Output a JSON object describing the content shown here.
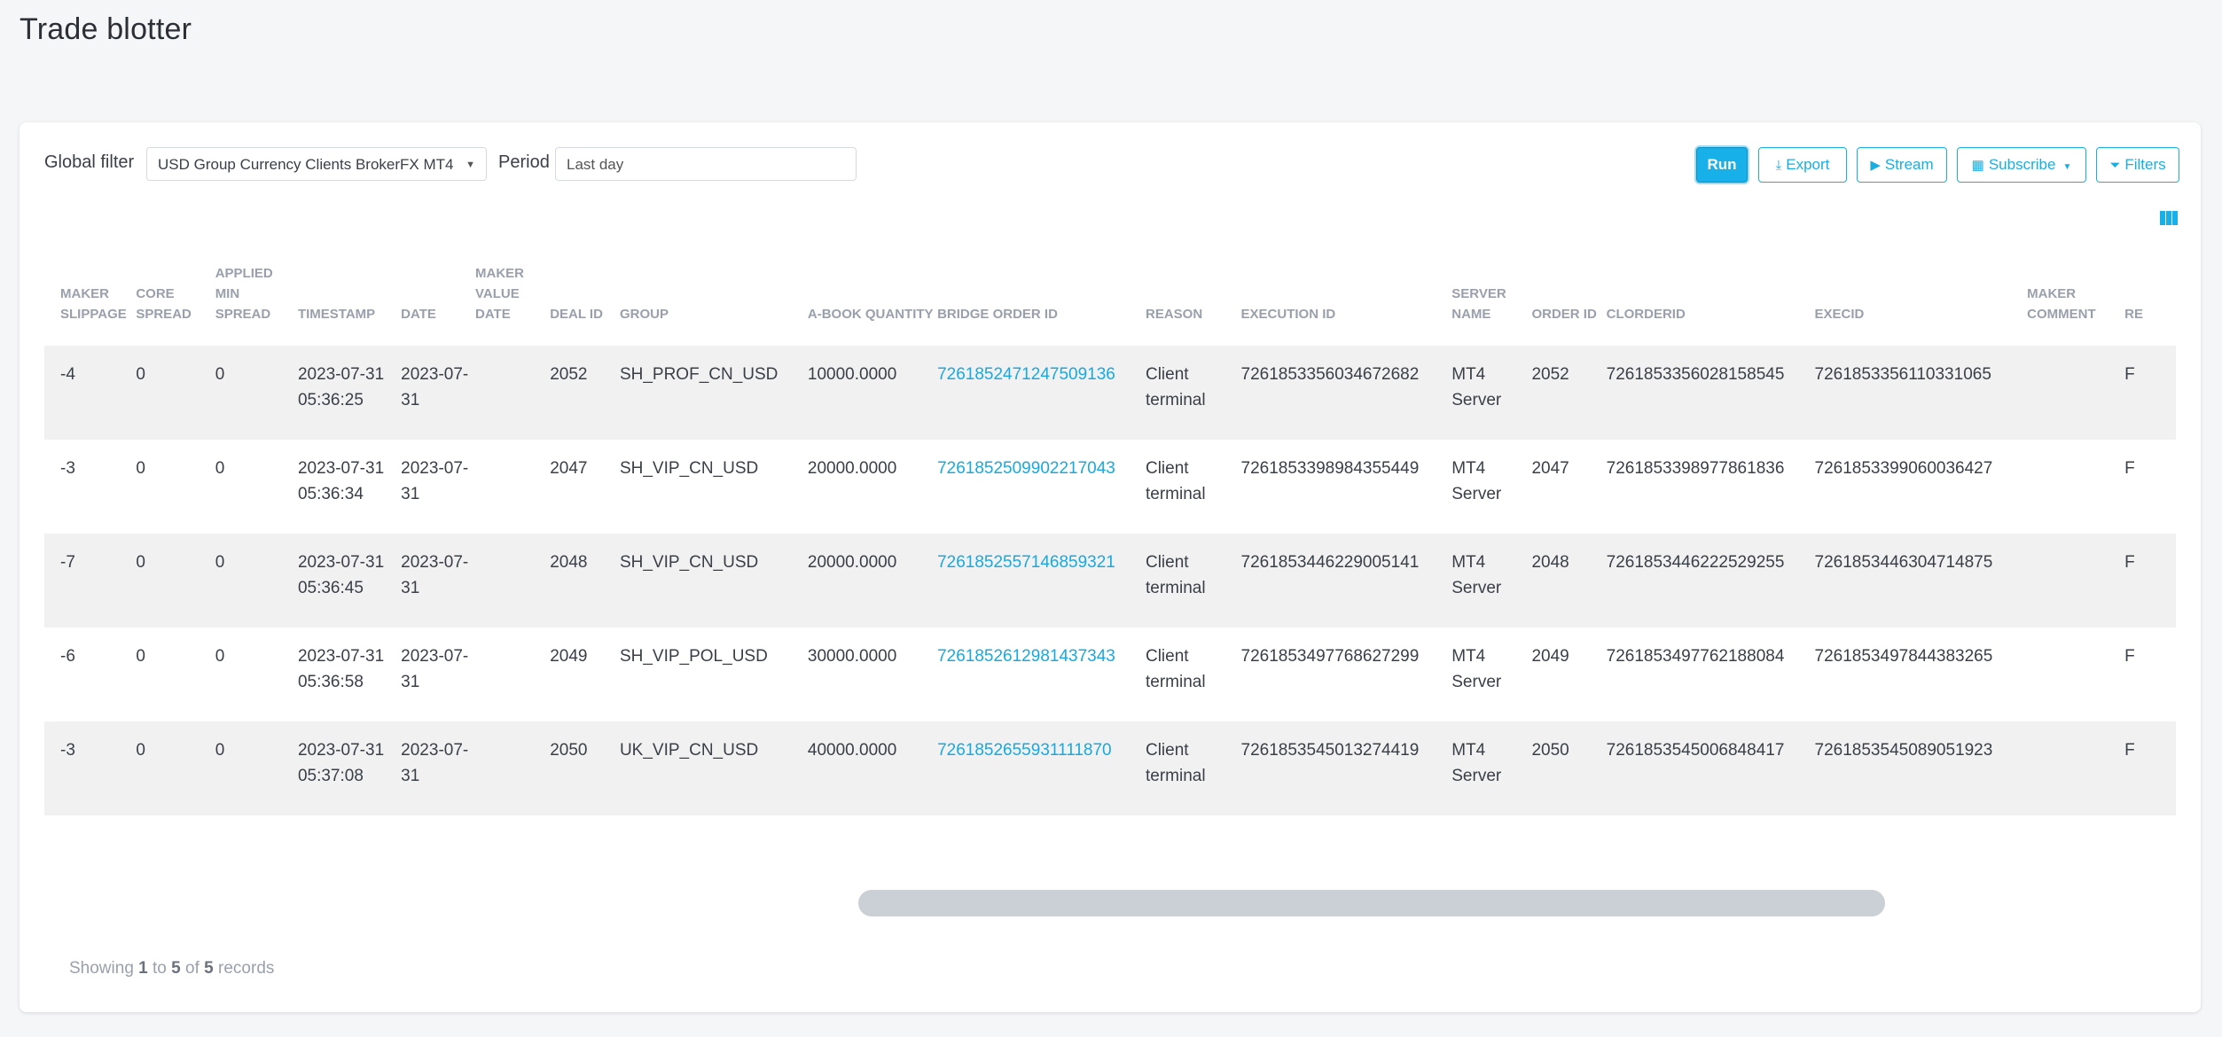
{
  "page": {
    "title": "Trade blotter"
  },
  "toolbar": {
    "global_filter_label": "Global filter",
    "global_filter_value": "USD Group Currency Clients BrokerFX MT4",
    "period_label": "Period",
    "period_value": "Last day",
    "buttons": {
      "run": "Run",
      "export": "Export",
      "stream": "Stream",
      "subscribe": "Subscribe",
      "filters": "Filters"
    },
    "icons": {
      "export": "download-icon",
      "stream": "play-icon",
      "subscribe": "calendar-icon",
      "filters": "funnel-icon",
      "columns": "columns-icon"
    }
  },
  "table": {
    "headers": [
      "MAKER SLIPPAGE",
      "CORE SPREAD",
      "APPLIED MIN SPREAD",
      "TIMESTAMP",
      "DATE",
      "MAKER VALUE DATE",
      "DEAL ID",
      "GROUP",
      "A-BOOK QUANTITY",
      "BRIDGE ORDER ID",
      "REASON",
      "EXECUTION ID",
      "SERVER NAME",
      "ORDER ID",
      "CLORDERID",
      "EXECID",
      "MAKER COMMENT",
      "RE"
    ],
    "rows": [
      [
        "-4",
        "0",
        "0",
        "2023-07-31 05:36:25",
        "2023-07-31",
        "",
        "2052",
        "SH_PROF_CN_USD",
        "10000.0000",
        "7261852471247509136",
        "Client terminal",
        "7261853356034672682",
        "MT4 Server",
        "2052",
        "7261853356028158545",
        "7261853356110331065",
        "",
        "F"
      ],
      [
        "-3",
        "0",
        "0",
        "2023-07-31 05:36:34",
        "2023-07-31",
        "",
        "2047",
        "SH_VIP_CN_USD",
        "20000.0000",
        "7261852509902217043",
        "Client terminal",
        "7261853398984355449",
        "MT4 Server",
        "2047",
        "7261853398977861836",
        "7261853399060036427",
        "",
        "F"
      ],
      [
        "-7",
        "0",
        "0",
        "2023-07-31 05:36:45",
        "2023-07-31",
        "",
        "2048",
        "SH_VIP_CN_USD",
        "20000.0000",
        "7261852557146859321",
        "Client terminal",
        "7261853446229005141",
        "MT4 Server",
        "2048",
        "7261853446222529255",
        "7261853446304714875",
        "",
        "F"
      ],
      [
        "-6",
        "0",
        "0",
        "2023-07-31 05:36:58",
        "2023-07-31",
        "",
        "2049",
        "SH_VIP_POL_USD",
        "30000.0000",
        "7261852612981437343",
        "Client terminal",
        "7261853497768627299",
        "MT4 Server",
        "2049",
        "7261853497762188084",
        "7261853497844383265",
        "",
        "F"
      ],
      [
        "-3",
        "0",
        "0",
        "2023-07-31 05:37:08",
        "2023-07-31",
        "",
        "2050",
        "UK_VIP_CN_USD",
        "40000.0000",
        "7261852655931111870",
        "Client terminal",
        "7261853545013274419",
        "MT4 Server",
        "2050",
        "7261853545006848417",
        "7261853545089051923",
        "",
        "F"
      ]
    ]
  },
  "footer": {
    "prefix": "Showing",
    "from": "1",
    "to_word": "to",
    "to": "5",
    "of_word": "of",
    "total": "5",
    "suffix": "records"
  },
  "colors": {
    "accent": "#17b0e8",
    "row_stripe": "#f1f1f1"
  }
}
